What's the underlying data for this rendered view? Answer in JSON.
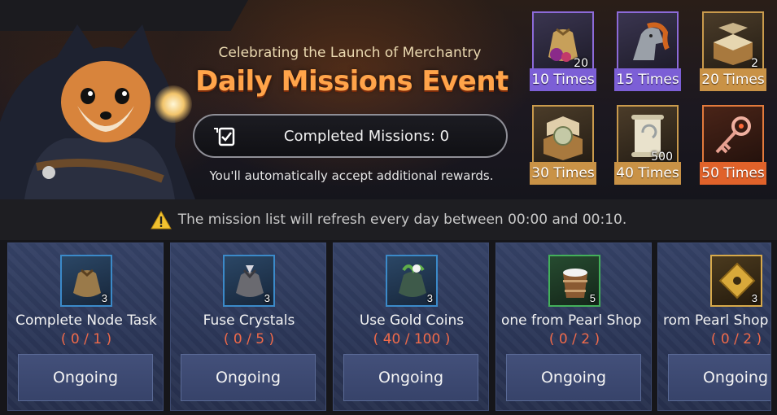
{
  "banner": {
    "subtitle": "Celebrating the Launch of Merchantry",
    "title": "Daily Missions Event",
    "completed_label": "Completed Missions: 0",
    "auto_note": "You'll automatically accept additional rewards."
  },
  "rewards": [
    {
      "icon": "coin-pouch-icon",
      "qty": "20",
      "label": "10 Times",
      "tier": "purple"
    },
    {
      "icon": "horse-head-icon",
      "qty": "",
      "label": "15 Times",
      "tier": "purple"
    },
    {
      "icon": "treasure-chest-icon",
      "qty": "2",
      "label": "20 Times",
      "tier": "gold"
    },
    {
      "icon": "orb-chest-icon",
      "qty": "",
      "label": "30 Times",
      "tier": "gold"
    },
    {
      "icon": "scroll-icon",
      "qty": "500",
      "label": "40 Times",
      "tier": "gold"
    },
    {
      "icon": "ornate-key-icon",
      "qty": "",
      "label": "50 Times",
      "tier": "orange"
    }
  ],
  "notice": {
    "text": "The mission list will refresh every day between 00:00 and 00:10."
  },
  "missions": [
    {
      "icon": "pouch-icon",
      "qty": "3",
      "name": "Complete Node Task",
      "progress": "( 0 / 1 )",
      "button": "Ongoing"
    },
    {
      "icon": "crystal-pouch-icon",
      "qty": "3",
      "name": "Fuse Crystals",
      "progress": "( 0 / 5 )",
      "button": "Ongoing"
    },
    {
      "icon": "herb-pouch-icon",
      "qty": "3",
      "name": "Use Gold Coins",
      "progress": "( 40 / 100 )",
      "button": "Ongoing"
    },
    {
      "icon": "bucket-icon",
      "qty": "5",
      "name": "one from Pearl Shop",
      "progress": "( 0 / 2 )",
      "button": "Ongoing"
    },
    {
      "icon": "gold-tile-icon",
      "qty": "3",
      "name": "rom Pearl Shop",
      "progress": "( 0 / 2 )",
      "button": "Ongoing"
    }
  ]
}
